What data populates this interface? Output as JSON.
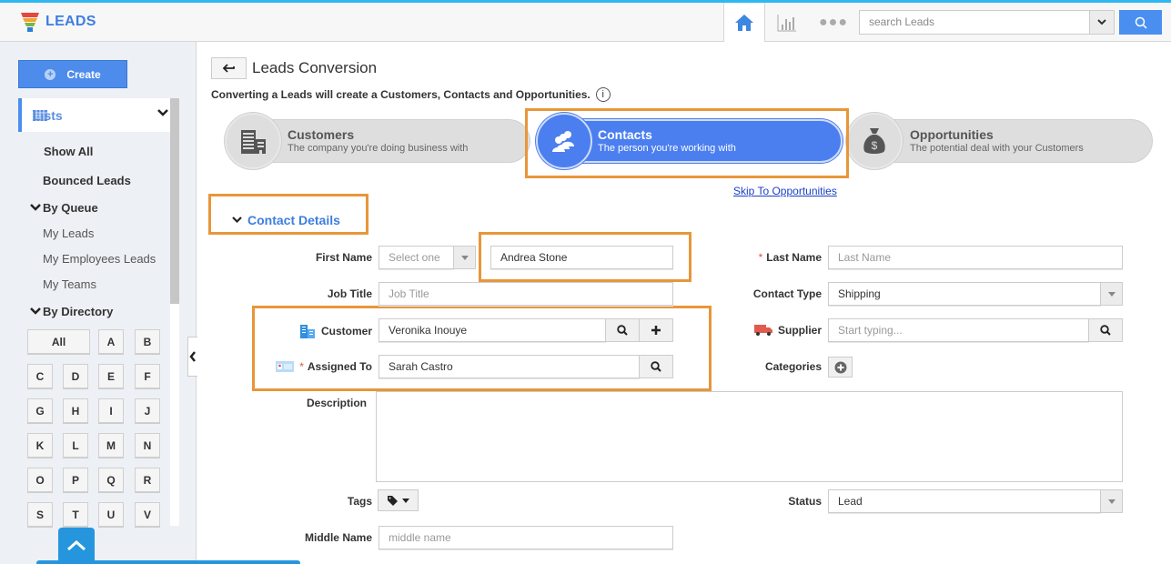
{
  "app": {
    "name": "LEADS",
    "accent_color": "#3d7ee0",
    "highlight_color": "#e8963a"
  },
  "topnav": {
    "icons": [
      "home-icon",
      "chart-icon",
      "more-icon"
    ],
    "search": {
      "placeholder": "search Leads",
      "value": ""
    }
  },
  "sidebar": {
    "create_label": "Create",
    "lists_label": "Lists",
    "items": [
      {
        "label": "Show All"
      },
      {
        "label": "Bounced Leads"
      }
    ],
    "queue_group": {
      "label": "By Queue",
      "items": [
        "My Leads",
        "My Employees Leads",
        "My Teams"
      ]
    },
    "directory_group": {
      "label": "By Directory",
      "letters": [
        "All",
        "A",
        "B",
        "C",
        "D",
        "E",
        "F",
        "G",
        "H",
        "I",
        "J",
        "K",
        "L",
        "M",
        "N",
        "O",
        "P",
        "Q",
        "R",
        "S",
        "T",
        "U",
        "V"
      ]
    }
  },
  "page": {
    "title": "Leads Conversion",
    "subtitle": "Converting a Leads will create a Customers, Contacts and Opportunities.",
    "info_icon": "i",
    "steps": [
      {
        "title": "Customers",
        "subtitle": "The company you're doing business with",
        "active": false
      },
      {
        "title": "Contacts",
        "subtitle": "The person you're working with",
        "active": true
      },
      {
        "title": "Opportunities",
        "subtitle": "The potential deal with your Customers",
        "active": false
      }
    ],
    "skip_link": "Skip To Opportunities",
    "section_title": "Contact Details"
  },
  "form": {
    "first_name": {
      "label": "First Name",
      "salutation_placeholder": "Select one",
      "value": "Andrea Stone"
    },
    "last_name": {
      "label": "Last Name",
      "placeholder": "Last Name",
      "required": true
    },
    "job_title": {
      "label": "Job Title",
      "placeholder": "Job Title"
    },
    "contact_type": {
      "label": "Contact Type",
      "value": "Shipping"
    },
    "customer": {
      "label": "Customer",
      "value": "Veronika Inouye"
    },
    "supplier": {
      "label": "Supplier",
      "placeholder": "Start typing..."
    },
    "assigned_to": {
      "label": "Assigned To",
      "value": "Sarah Castro",
      "required": true
    },
    "categories": {
      "label": "Categories"
    },
    "description": {
      "label": "Description",
      "value": ""
    },
    "tags": {
      "label": "Tags"
    },
    "status": {
      "label": "Status",
      "value": "Lead"
    },
    "middle_name": {
      "label": "Middle Name",
      "placeholder": "middle name"
    },
    "required_marker": "*"
  }
}
